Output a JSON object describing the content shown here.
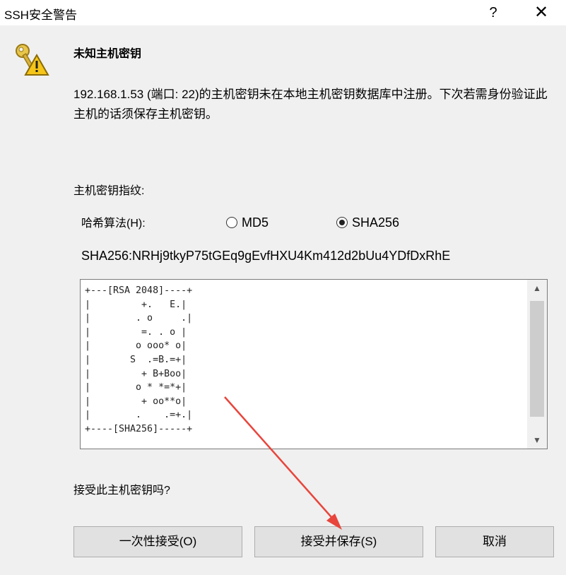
{
  "window": {
    "title": "SSH安全警告",
    "help_label": "?",
    "close_label": "✕"
  },
  "icons": {
    "warning": "key-warning-icon"
  },
  "header": {
    "heading": "未知主机密钥",
    "message": "192.168.1.53 (端口: 22)的主机密钥未在本地主机密钥数据库中注册。下次若需身份验证此主机的话须保存主机密钥。"
  },
  "fingerprint": {
    "label": "主机密钥指纹:",
    "algorithm_label": "哈希算法(H):",
    "options": [
      {
        "label": "MD5",
        "checked": false
      },
      {
        "label": "SHA256",
        "checked": true
      }
    ],
    "value": "SHA256:NRHj9tkyP75tGEq9gEvfHXU4Km412d2bUu4YDfDxRhE"
  },
  "randomart": "+---[RSA 2048]----+\n|         +.   E.|\n|        . o     .|\n|         =. . o |\n|        o ooo* o|\n|       S  .=B.=+|\n|         + B+Boo|\n|        o * *=*+|\n|         + oo**o|\n|        .    .=+.|\n+----[SHA256]-----+",
  "question": "接受此主机密钥吗?",
  "buttons": {
    "accept_once": "一次性接受(O)",
    "accept_save": "接受并保存(S)",
    "cancel": "取消"
  },
  "colors": {
    "annotation_arrow": "#e8453c"
  }
}
